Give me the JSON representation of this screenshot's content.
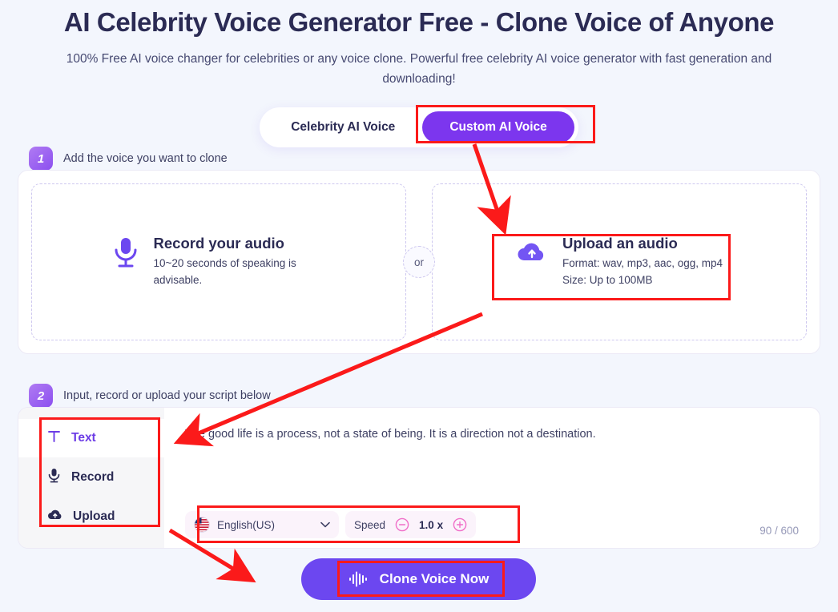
{
  "header": {
    "title": "AI Celebrity Voice Generator Free - Clone Voice of Anyone",
    "subtitle": "100% Free AI voice changer for celebrities or any voice clone. Powerful free celebrity AI voice generator with fast generation and downloading!"
  },
  "tabs": [
    {
      "label": "Celebrity AI Voice",
      "active": false
    },
    {
      "label": "Custom AI Voice",
      "active": true
    }
  ],
  "step1": {
    "number": "1",
    "label": "Add the voice you want to clone",
    "record": {
      "title": "Record your audio",
      "subtitle": "10~20 seconds of speaking is advisable.",
      "icon": "microphone-icon"
    },
    "or": "or",
    "upload": {
      "title": "Upload an audio",
      "line1": "Format: wav, mp3, aac, ogg, mp4",
      "line2": "Size: Up to 100MB",
      "icon": "cloud-upload-icon"
    }
  },
  "step2": {
    "number": "2",
    "label": "Input, record or upload your script below",
    "side_tabs": [
      {
        "label": "Text",
        "icon": "text-t-icon",
        "active": true
      },
      {
        "label": "Record",
        "icon": "microphone-icon",
        "active": false
      },
      {
        "label": "Upload",
        "icon": "cloud-upload-icon",
        "active": false
      }
    ],
    "script_text": "The good life is a process, not a state of being. It is a direction not a destination.",
    "char_count": "90 / 600",
    "language": {
      "value": "English(US)",
      "flag": "us-flag-icon",
      "chevron": "chevron-down-icon"
    },
    "speed": {
      "label": "Speed",
      "value": "1.0 x",
      "minus": "circle-minus-icon",
      "plus": "circle-plus-icon"
    }
  },
  "cta": {
    "label": "Clone Voice Now",
    "icon": "waveform-icon"
  },
  "colors": {
    "page_bg": "#f3f6fd",
    "accent_purple": "#6c47f0",
    "tab_purple": "#7c36ee",
    "badge_purple": "#8b4ff0",
    "title_navy": "#2b2b54",
    "highlight_red": "#fb1a1a",
    "pink_control": "#fbf3fb",
    "speed_pink": "#f06ec8"
  }
}
